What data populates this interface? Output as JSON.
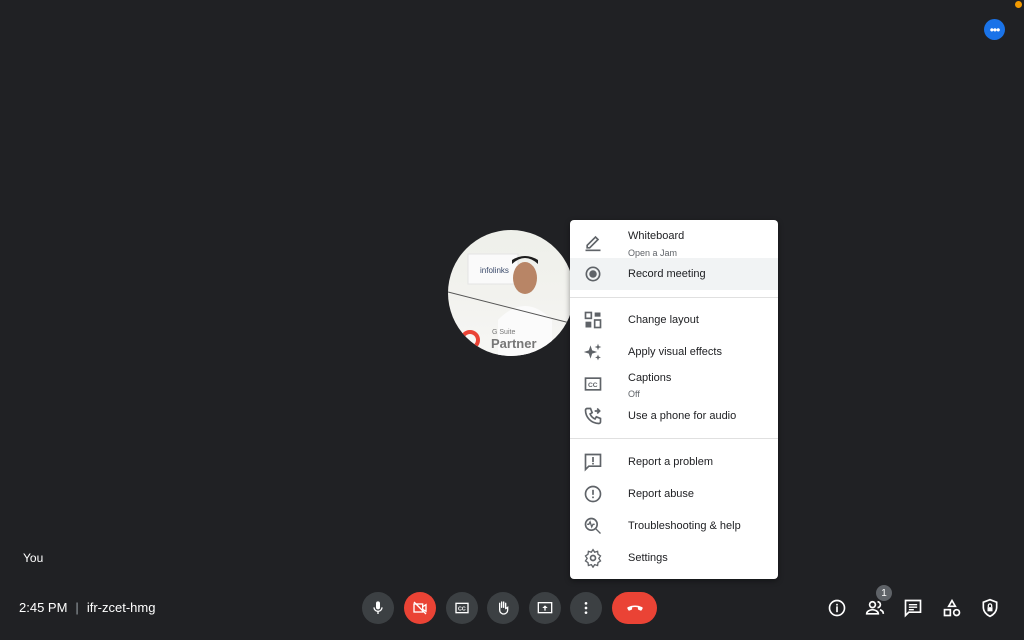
{
  "top": {
    "more_icon": "more-horiz-icon",
    "notification_color": "#f29900",
    "accent": "#1a73e8"
  },
  "tile": {
    "name": "You",
    "avatar_text": [
      "infolinks",
      "G Suite",
      "Partner"
    ]
  },
  "footer": {
    "time": "2:45 PM",
    "separator": "|",
    "meeting_code": "ifr-zcet-hmg"
  },
  "controls": [
    "mic-icon",
    "camera-off-icon",
    "captions-icon",
    "raise-hand-icon",
    "present-icon",
    "more-vert-icon",
    "hangup-icon"
  ],
  "right_controls": {
    "participants_count": "1",
    "icons": [
      "info-icon",
      "people-icon",
      "chat-icon",
      "activities-icon",
      "host-controls-icon"
    ]
  },
  "menu": {
    "items": [
      {
        "label": "Whiteboard",
        "sub": "Open a Jam"
      },
      {
        "label": "Record meeting"
      },
      {
        "label": "Change layout"
      },
      {
        "label": "Apply visual effects"
      },
      {
        "label": "Captions",
        "sub": "Off"
      },
      {
        "label": "Use a phone for audio"
      },
      {
        "label": "Report a problem"
      },
      {
        "label": "Report abuse"
      },
      {
        "label": "Troubleshooting & help"
      },
      {
        "label": "Settings"
      }
    ]
  }
}
